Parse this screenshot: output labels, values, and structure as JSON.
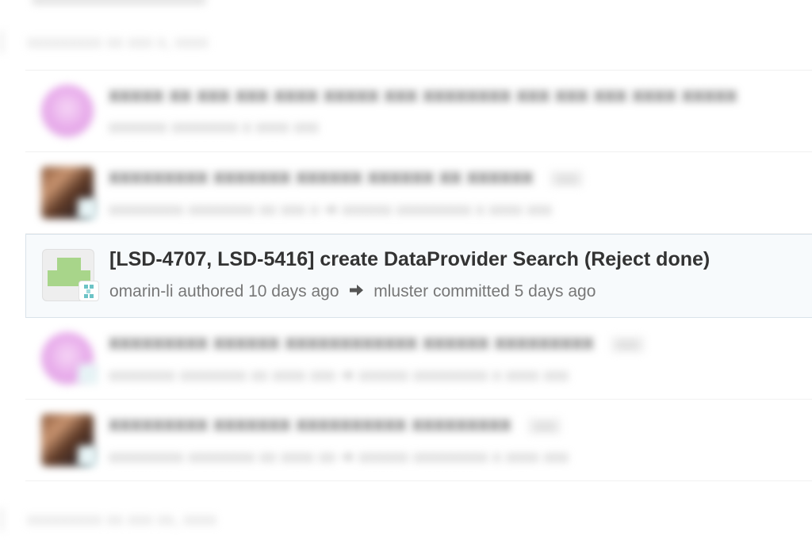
{
  "selected_commit": {
    "title": "[LSD-4707, LSD-5416] create DataProvider Search (Reject done)",
    "author": "omarin-li",
    "authored_text": "authored",
    "authored_time": "10 days ago",
    "arrow_icon": "arrow-right-icon",
    "committer": "mluster",
    "committed_text": "committed",
    "committed_time": "5 days ago"
  },
  "colors": {
    "selected_background": "#f7fafc",
    "selected_border": "#d9e3ea",
    "title_text": "#333333",
    "meta_text": "#777777"
  }
}
